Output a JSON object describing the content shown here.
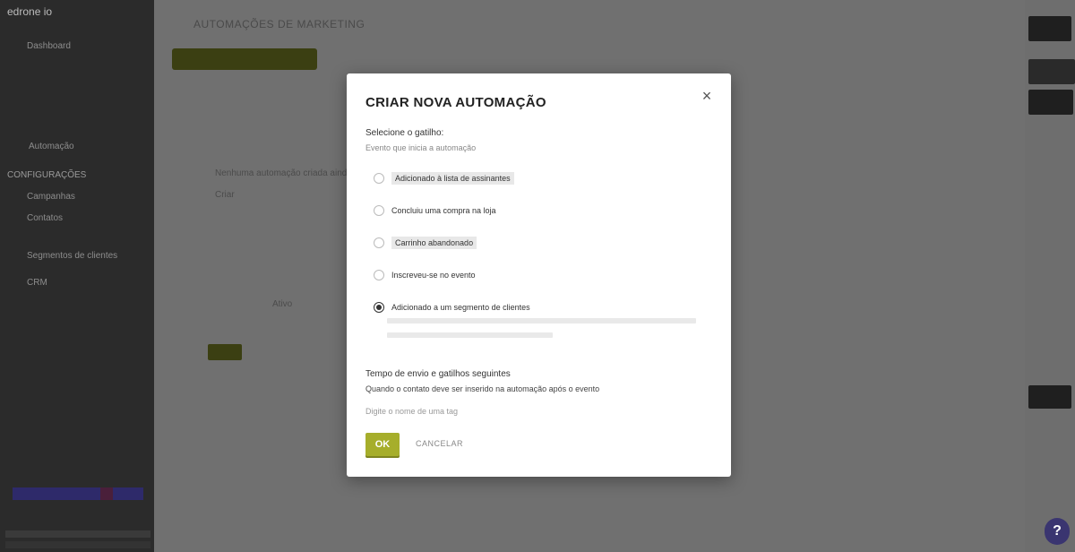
{
  "colors": {
    "accent": "#a6ae2b",
    "overlay": "#6b6b6b",
    "sidebar": "#2b2b2b",
    "modal_bg": "#ffffff",
    "help_button": "#3a3570"
  },
  "sidebar": {
    "brand": "edrone io",
    "items": [
      {
        "label": "Dashboard",
        "icon": "home-icon"
      },
      {
        "label": "Automação",
        "icon": "bolt-icon"
      },
      {
        "label": "Campanhas",
        "icon": "megaphone-icon"
      },
      {
        "label": "Contatos",
        "icon": "user-icon"
      },
      {
        "label": "Segmentos de clientes",
        "icon": "segment-icon"
      },
      {
        "label": "CRM",
        "icon": "crm-icon"
      }
    ],
    "section_label": "CONFIGURAÇÕES"
  },
  "main": {
    "page_title": "AUTOMAÇÕES DE MARKETING",
    "rows": [
      "Nenhuma automação criada ainda",
      "Criar",
      "Ativo"
    ]
  },
  "help": {
    "label": "?"
  },
  "modal": {
    "title": "CRIAR NOVA AUTOMAÇÃO",
    "close_label": "×",
    "trigger_label": "Selecione o gatilho:",
    "trigger_help": "Evento que inicia a automação",
    "options": [
      {
        "label": "Adicionado à lista de assinantes",
        "selected": false,
        "highlight": true
      },
      {
        "label": "Concluiu uma compra na loja",
        "selected": false,
        "highlight": false
      },
      {
        "label": "Carrinho abandonado",
        "selected": false,
        "highlight": true
      },
      {
        "label": "Inscreveu-se no evento",
        "selected": false,
        "highlight": false
      },
      {
        "label": "Adicionado a um segmento de clientes",
        "selected": true,
        "highlight": false
      }
    ],
    "tags_label": "Tempo de envio e gatilhos seguintes",
    "tags_text": "Quando o contato deve ser inserido na automação após o evento",
    "tags_extra": "Digite o nome de uma tag",
    "ok_label": "OK",
    "cancel_label": "CANCELAR"
  }
}
